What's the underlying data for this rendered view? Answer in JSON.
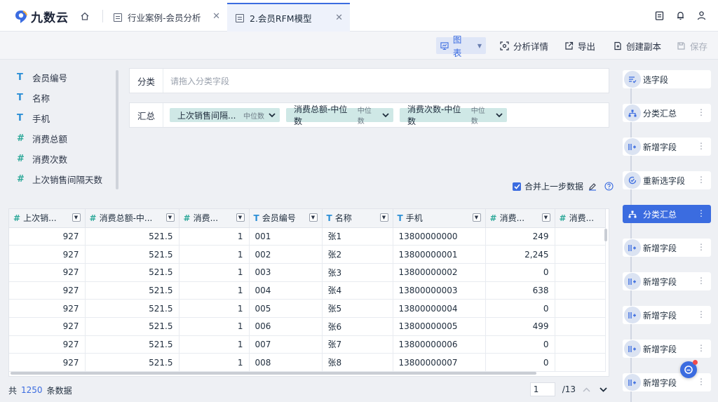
{
  "brand": {
    "name": "九数云"
  },
  "tabs": [
    {
      "label": "行业案例-会员分析"
    },
    {
      "label": "2.会员RFM模型"
    }
  ],
  "toolbar": {
    "chart": "图表",
    "detail": "分析详情",
    "export": "导出",
    "copy": "创建副本",
    "save": "保存"
  },
  "fields": [
    {
      "type": "T",
      "label": "会员编号"
    },
    {
      "type": "T",
      "label": "名称"
    },
    {
      "type": "T",
      "label": "手机"
    },
    {
      "type": "#",
      "label": "消费总额"
    },
    {
      "type": "#",
      "label": "消费次数"
    },
    {
      "type": "#",
      "label": "上次销售间隔天数"
    }
  ],
  "zones": {
    "category_label": "分类",
    "category_placeholder": "请拖入分类字段",
    "summary_label": "汇总",
    "chips": [
      {
        "label": "上次销售间隔...",
        "agg": "中位数"
      },
      {
        "label": "消费总额-中位数",
        "agg": "中位数"
      },
      {
        "label": "消费次数-中位数",
        "agg": "中位数"
      }
    ]
  },
  "merge": {
    "label": "合并上一步数据",
    "checked": true
  },
  "table": {
    "columns": [
      {
        "type": "#",
        "label": "上次销..."
      },
      {
        "type": "#",
        "label": "消费总额-中..."
      },
      {
        "type": "#",
        "label": "消费..."
      },
      {
        "type": "T",
        "label": "会员编号"
      },
      {
        "type": "T",
        "label": "名称"
      },
      {
        "type": "T",
        "label": "手机"
      },
      {
        "type": "#",
        "label": "消费..."
      },
      {
        "type": "#",
        "label": "消费..."
      }
    ],
    "rows": [
      [
        "927",
        "521.5",
        "1",
        "001",
        "张1",
        "13800000000",
        "249",
        ""
      ],
      [
        "927",
        "521.5",
        "1",
        "002",
        "张2",
        "13800000001",
        "2,245",
        ""
      ],
      [
        "927",
        "521.5",
        "1",
        "003",
        "张3",
        "13800000002",
        "0",
        ""
      ],
      [
        "927",
        "521.5",
        "1",
        "004",
        "张4",
        "13800000003",
        "638",
        ""
      ],
      [
        "927",
        "521.5",
        "1",
        "005",
        "张5",
        "13800000004",
        "0",
        ""
      ],
      [
        "927",
        "521.5",
        "1",
        "006",
        "张6",
        "13800000005",
        "499",
        ""
      ],
      [
        "927",
        "521.5",
        "1",
        "007",
        "张7",
        "13800000006",
        "0",
        ""
      ],
      [
        "927",
        "521.5",
        "1",
        "008",
        "张8",
        "13800000007",
        "0",
        ""
      ]
    ]
  },
  "footer": {
    "prefix": "共",
    "count": "1250",
    "suffix": "条数据",
    "page": "1",
    "pages": "/13"
  },
  "steps": [
    {
      "label": "选字段",
      "icon": "select-fields-icon",
      "more": false,
      "active": false
    },
    {
      "label": "分类汇总",
      "icon": "group-summary-icon",
      "more": true,
      "active": false
    },
    {
      "label": "新增字段",
      "icon": "add-field-icon",
      "more": true,
      "active": false
    },
    {
      "label": "重新选字段",
      "icon": "reselect-fields-icon",
      "more": true,
      "active": false
    },
    {
      "label": "分类汇总",
      "icon": "group-summary-icon",
      "more": true,
      "active": true
    },
    {
      "label": "新增字段",
      "icon": "add-field-icon",
      "more": true,
      "active": false
    },
    {
      "label": "新增字段",
      "icon": "add-field-icon",
      "more": true,
      "active": false
    },
    {
      "label": "新增字段",
      "icon": "add-field-icon",
      "more": true,
      "active": false
    },
    {
      "label": "新增字段",
      "icon": "add-field-icon",
      "more": true,
      "active": false
    },
    {
      "label": "新增字段",
      "icon": "add-field-icon",
      "more": true,
      "active": false
    }
  ],
  "colors": {
    "accent": "#3b6ce0",
    "chip": "#cfe8e6",
    "text_type": "#2c8fd6",
    "num_type": "#2fa99a"
  }
}
